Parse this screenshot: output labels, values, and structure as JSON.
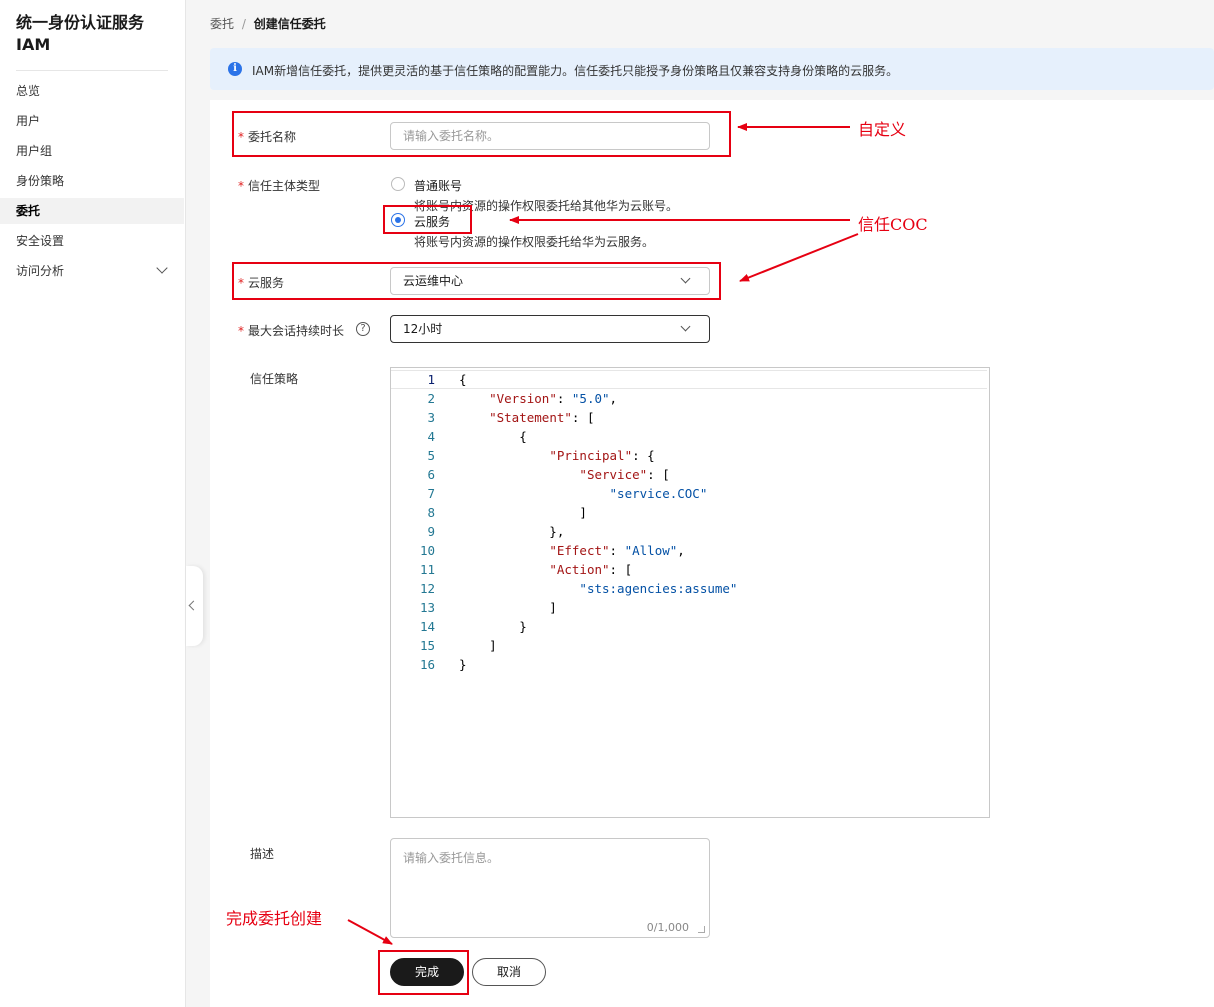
{
  "sidebar": {
    "title": "统一身份认证服务 IAM",
    "items": [
      {
        "label": "总览"
      },
      {
        "label": "用户"
      },
      {
        "label": "用户组"
      },
      {
        "label": "身份策略"
      },
      {
        "label": "委托"
      },
      {
        "label": "安全设置"
      },
      {
        "label": "访问分析"
      }
    ]
  },
  "breadcrumb": {
    "parent": "委托",
    "separator": "/",
    "current": "创建信任委托"
  },
  "info": {
    "message": "IAM新增信任委托，提供更灵活的基于信任策略的配置能力。信任委托只能授予身份策略且仅兼容支持身份策略的云服务。"
  },
  "form": {
    "name": {
      "label": "委托名称",
      "placeholder": "请输入委托名称。"
    },
    "principal": {
      "label": "信任主体类型",
      "options": [
        {
          "label": "普通账号",
          "desc": "将账号内资源的操作权限委托给其他华为云账号。",
          "selected": false
        },
        {
          "label": "云服务",
          "desc": "将账号内资源的操作权限委托给华为云服务。",
          "selected": true
        }
      ]
    },
    "service": {
      "label": "云服务",
      "value": "云运维中心"
    },
    "duration": {
      "label": "最大会话持续时长",
      "value": "12小时",
      "help": "?"
    },
    "policy": {
      "label": "信任策略",
      "lines": [
        {
          "n": "1",
          "t": "{"
        },
        {
          "n": "2",
          "t": "    \"Version\": \"5.0\","
        },
        {
          "n": "3",
          "t": "    \"Statement\": ["
        },
        {
          "n": "4",
          "t": "        {"
        },
        {
          "n": "5",
          "t": "            \"Principal\": {"
        },
        {
          "n": "6",
          "t": "                \"Service\": ["
        },
        {
          "n": "7",
          "t": "                    \"service.COC\""
        },
        {
          "n": "8",
          "t": "                ]"
        },
        {
          "n": "9",
          "t": "            },"
        },
        {
          "n": "10",
          "t": "            \"Effect\": \"Allow\","
        },
        {
          "n": "11",
          "t": "            \"Action\": ["
        },
        {
          "n": "12",
          "t": "                \"sts:agencies:assume\""
        },
        {
          "n": "13",
          "t": "            ]"
        },
        {
          "n": "14",
          "t": "        }"
        },
        {
          "n": "15",
          "t": "    ]"
        },
        {
          "n": "16",
          "t": "}"
        }
      ]
    },
    "description": {
      "label": "描述",
      "placeholder": "请输入委托信息。",
      "counter": "0/1,000"
    }
  },
  "actions": {
    "confirm": "完成",
    "cancel": "取消"
  },
  "annotations": {
    "custom": "自定义",
    "trust_coc": "信任COC",
    "finish": "完成委托创建",
    "color": "#e60012"
  }
}
